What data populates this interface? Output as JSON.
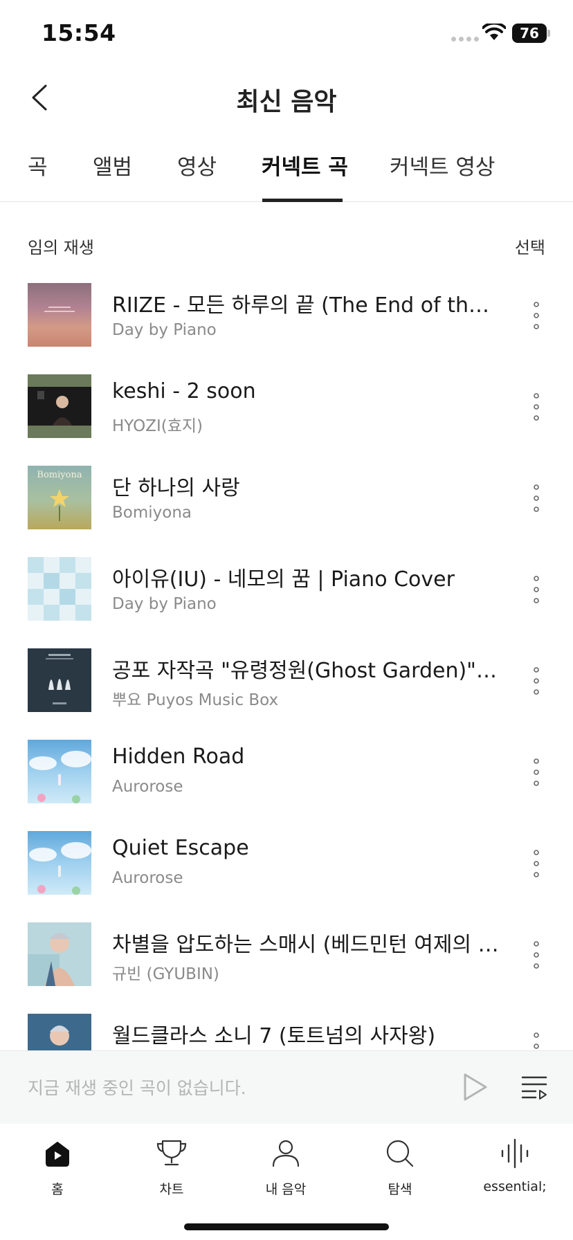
{
  "status_bar": {
    "time": "15:54",
    "battery": "76"
  },
  "header": {
    "title": "최신 음악"
  },
  "tabs": [
    {
      "label": "곡"
    },
    {
      "label": "앨범"
    },
    {
      "label": "영상"
    },
    {
      "label": "커넥트 곡",
      "active": true
    },
    {
      "label": "커넥트 영상"
    }
  ],
  "list_header": {
    "shuffle_label": "임의 재생",
    "select_label": "선택"
  },
  "songs": [
    {
      "title": "RIIZE - 모든 하루의 끝 (The End of the Day) Piano Cover",
      "artist": "Day by Piano"
    },
    {
      "title": "keshi - 2 soon",
      "artist": "HYOZI(효지)"
    },
    {
      "title": "단 하나의 사랑",
      "artist": "Bomiyona",
      "cover_text": "Bomiyona"
    },
    {
      "title": "아이유(IU) - 네모의 꿈 | Piano Cover",
      "artist": "Day by Piano"
    },
    {
      "title": "공포 자작곡 \"유령정원(Ghost Garden)\" 오르골 버전",
      "artist": "뿌요 Puyos Music Box"
    },
    {
      "title": "Hidden Road",
      "artist": "Aurorose"
    },
    {
      "title": "Quiet Escape",
      "artist": "Aurorose"
    },
    {
      "title": "차별을 압도하는 스매시 (베드민턴 여제의 군림)",
      "artist": "규빈 (GYUBIN)"
    },
    {
      "title": "월드클라스 소니 7 (토트넘의 사자왕)",
      "artist": ""
    }
  ],
  "mini_player": {
    "empty_text": "지금 재생 중인 곡이 없습니다."
  },
  "bottom_nav": [
    {
      "label": "홈",
      "icon": "home-icon"
    },
    {
      "label": "차트",
      "icon": "trophy-icon"
    },
    {
      "label": "내 음악",
      "icon": "person-icon"
    },
    {
      "label": "탐색",
      "icon": "search-icon"
    },
    {
      "label": "essential;",
      "icon": "waveform-icon"
    }
  ]
}
